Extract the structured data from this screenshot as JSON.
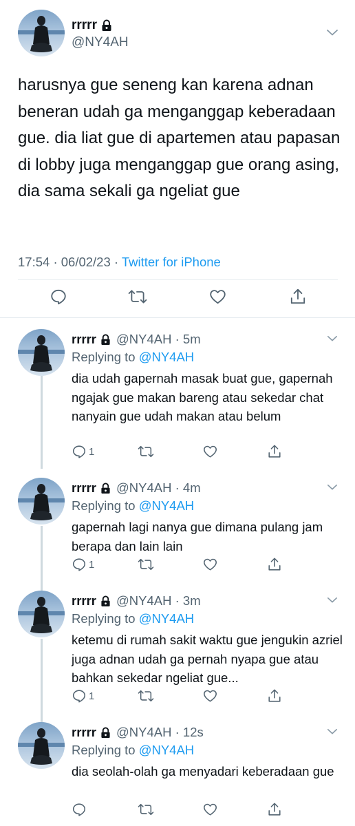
{
  "main_tweet": {
    "display_name": "rrrrr",
    "handle": "@NY4AH",
    "text": "harusnya gue seneng kan karena adnan beneran udah ga menganggap keberadaan gue. dia liat gue di apartemen atau papasan di lobby juga menganggap gue orang asing, dia sama sekali ga ngeliat gue",
    "time": "17:54",
    "date": "06/02/23",
    "source": "Twitter for iPhone"
  },
  "replies": [
    {
      "display_name": "rrrrr",
      "handle_time": "@NY4AH · 5m",
      "replying_prefix": "Replying to",
      "replying_to": "@NY4AH",
      "text": "dia udah gapernah masak buat gue, gapernah ngajak gue makan bareng atau sekedar chat nanyain gue udah makan atau belum",
      "reply_count": "1"
    },
    {
      "display_name": "rrrrr",
      "handle_time": "@NY4AH · 4m",
      "replying_prefix": "Replying to",
      "replying_to": "@NY4AH",
      "text": "gapernah lagi nanya gue dimana pulang jam berapa dan lain lain",
      "reply_count": "1"
    },
    {
      "display_name": "rrrrr",
      "handle_time": "@NY4AH · 3m",
      "replying_prefix": "Replying to",
      "replying_to": "@NY4AH",
      "text": "ketemu di rumah sakit waktu gue jengukin azriel juga adnan udah ga pernah nyapa gue atau bahkan sekedar ngeliat gue...",
      "reply_count": "1"
    },
    {
      "display_name": "rrrrr",
      "handle_time": "@NY4AH · 12s",
      "replying_prefix": "Replying to",
      "replying_to": "@NY4AH",
      "text": "dia seolah-olah ga menyadari keberadaan gue",
      "reply_count": ""
    }
  ],
  "icons": [
    "lock-icon",
    "chevron-down-icon",
    "reply-icon",
    "retweet-icon",
    "like-icon",
    "share-icon"
  ],
  "colors": {
    "text": "#0f1419",
    "secondary": "#536471",
    "accent": "#1d9bf0",
    "divider": "#e6ecf0",
    "thread_line": "#cfd9de"
  }
}
